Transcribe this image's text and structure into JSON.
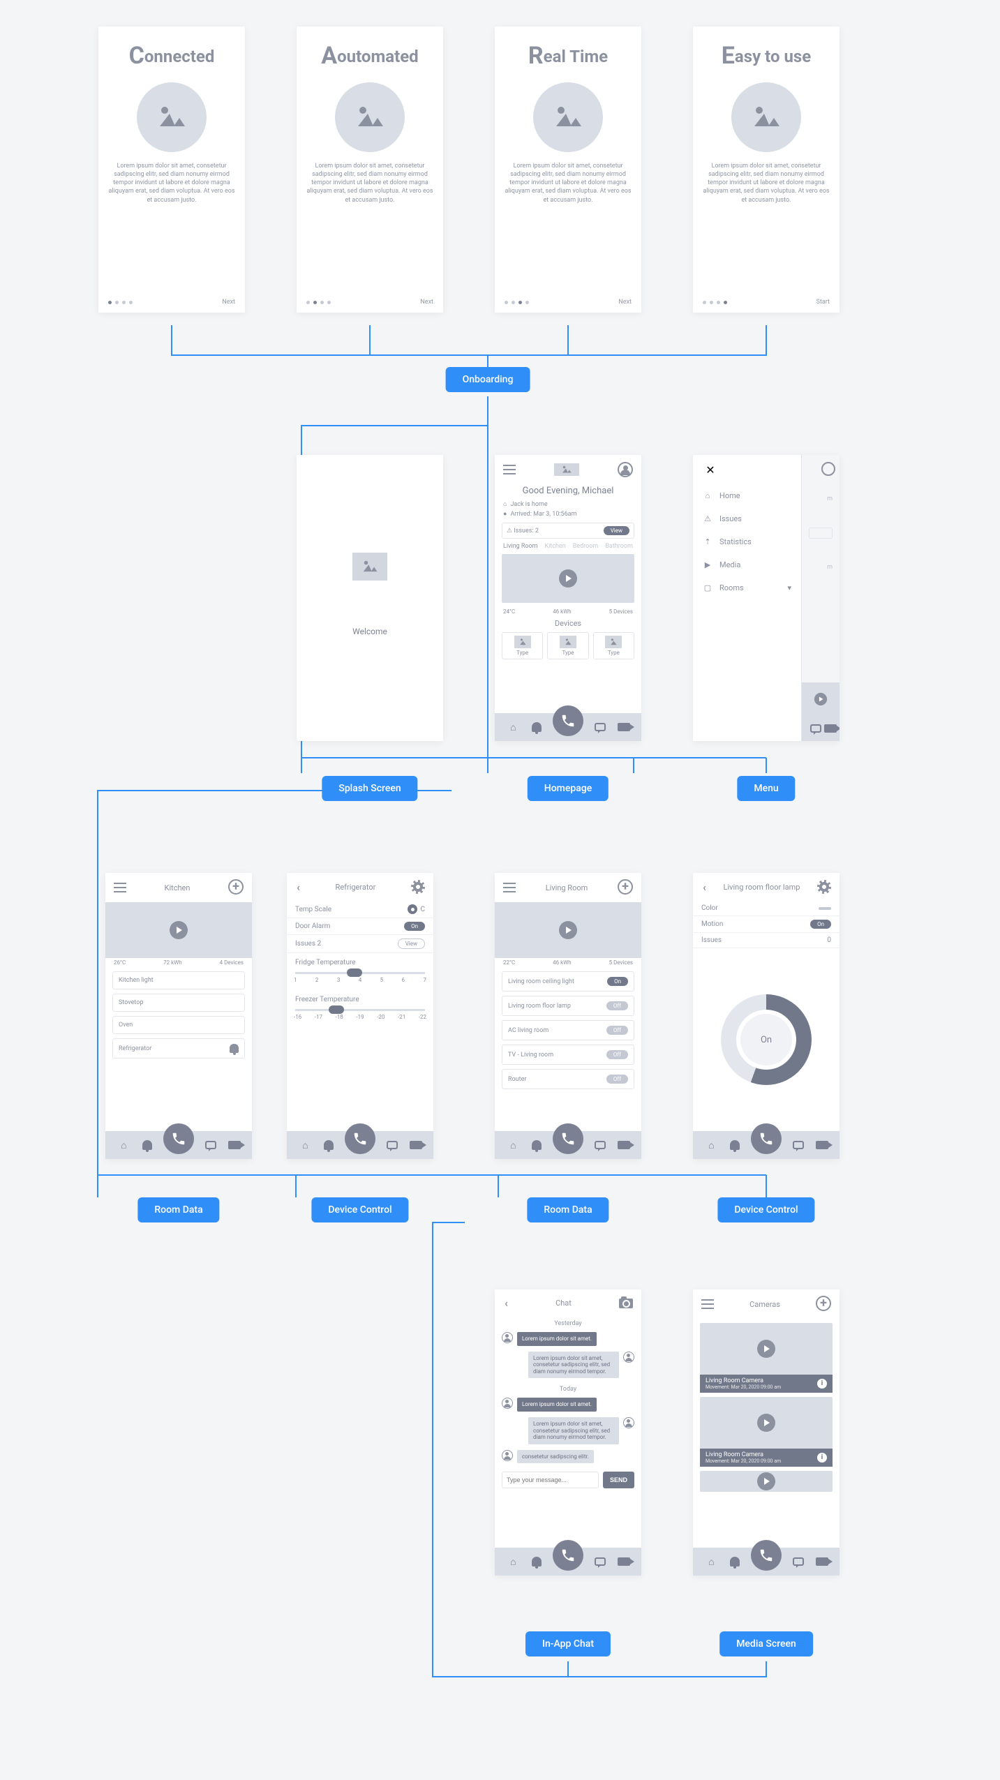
{
  "labels": {
    "onboarding": "Onboarding",
    "splash": "Splash Screen",
    "homepage": "Homepage",
    "menu": "Menu",
    "room_data_1": "Room Data",
    "device_control_1": "Device Control",
    "room_data_2": "Room Data",
    "device_control_2": "Device Control",
    "chat": "In-App Chat",
    "media": "Media Screen"
  },
  "onboarding": {
    "lorem": "Lorem ipsum dolor sit amet, consetetur sadipscing elitr, sed diam nonumy eirmod tempor invidunt ut labore et dolore magna aliquyam erat, sed diam voluptua. At vero eos et accusam justo.",
    "slides": [
      {
        "big": "C",
        "rest": "onnected",
        "action": "Next"
      },
      {
        "big": "A",
        "rest": "outomated",
        "action": "Next"
      },
      {
        "big": "R",
        "rest": "eal Time",
        "action": "Next"
      },
      {
        "big": "E",
        "rest": "asy to use",
        "action": "Start"
      }
    ]
  },
  "splash": {
    "welcome": "Welcome"
  },
  "homepage": {
    "greeting": "Good Evening, Michael",
    "status_1": "Jack is home",
    "status_2": "Arrived: Mar 3, 10:56am",
    "issues_text": "Issues: 2",
    "issues_btn": "View",
    "rooms": [
      "Living Room",
      "Kitchen",
      "Bedroom",
      "Bathroom"
    ],
    "stats": {
      "temp": "24°C",
      "power": "46 kWh",
      "devices": "5 Devices"
    },
    "devices_title": "Devices",
    "device_type_label": "Type"
  },
  "drawer": {
    "items": [
      {
        "icon": "⌂",
        "label": "Home"
      },
      {
        "icon": "⚠",
        "label": "Issues"
      },
      {
        "icon": "⇡",
        "label": "Statistics"
      },
      {
        "icon": "▶",
        "label": "Media"
      },
      {
        "icon": "▢",
        "label": "Rooms",
        "chevron": "▾"
      }
    ]
  },
  "kitchen": {
    "title": "Kitchen",
    "stats": {
      "temp": "26°C",
      "power": "72 kWh",
      "devices": "4 Devices"
    },
    "items": [
      "Kitchen light",
      "Stovetop",
      "Oven",
      "Refrigerator"
    ]
  },
  "fridge": {
    "title": "Refrigerator",
    "rows": [
      {
        "label": "Temp Scale",
        "val_type": "tog",
        "val": "C"
      },
      {
        "label": "Door Alarm",
        "val_type": "pill",
        "val": "On"
      },
      {
        "label": "Issues 2",
        "val_type": "view",
        "val": "View"
      }
    ],
    "slider1": {
      "label": "Fridge Temperature",
      "ticks": [
        "1",
        "2",
        "3",
        "4",
        "5",
        "6",
        "7"
      ],
      "pos": 40
    },
    "slider2": {
      "label": "Freezer Temperature",
      "ticks": [
        "-16",
        "-17",
        "-18",
        "-19",
        "-20",
        "-21",
        "-22"
      ],
      "pos": 26
    }
  },
  "living": {
    "title": "Living Room",
    "stats": {
      "temp": "22°C",
      "power": "46 kWh",
      "devices": "5 Devices"
    },
    "items": [
      {
        "label": "Living room ceiling light",
        "state": "On"
      },
      {
        "label": "Living room floor lamp",
        "state": "Off"
      },
      {
        "label": "AC living room",
        "state": "Off"
      },
      {
        "label": "TV - Living room",
        "state": "Off"
      },
      {
        "label": "Router",
        "state": "Off"
      }
    ]
  },
  "lamp": {
    "title": "Living room floor lamp",
    "rows": [
      {
        "label": "Color",
        "val": ""
      },
      {
        "label": "Motion",
        "val": "On"
      },
      {
        "label": "Issues",
        "val": "0"
      }
    ],
    "dial": "On"
  },
  "chat": {
    "title": "Chat",
    "day1": "Yesterday",
    "day2": "Today",
    "msgs": [
      {
        "side": "left",
        "tone": "dark",
        "text": "Lorem ipsum dolor sit amet."
      },
      {
        "side": "right",
        "tone": "light",
        "text": "Lorem ipsum dolor sit amet, consetetur sadipscing elitr, sed diam nonumy eirmod tempor."
      },
      {
        "side": "left",
        "tone": "dark",
        "text": "Lorem ipsum dolor sit amet."
      },
      {
        "side": "right",
        "tone": "light",
        "text": "Lorem ipsum dolor sit amet, consetetur sadipscing elitr, sed diam nonumy eirmod tempor."
      },
      {
        "side": "left",
        "tone": "light",
        "text": "consetetur sadipscing elitr."
      }
    ],
    "placeholder": "Type your message...",
    "send": "SEND"
  },
  "cameras": {
    "title": "Cameras",
    "clips": [
      {
        "name": "Living Room Camera",
        "sub": "Movement: Mar 20, 2020 09:00 am"
      },
      {
        "name": "Living Room Camera",
        "sub": "Movement: Mar 20, 2020 09:00 am"
      }
    ]
  }
}
